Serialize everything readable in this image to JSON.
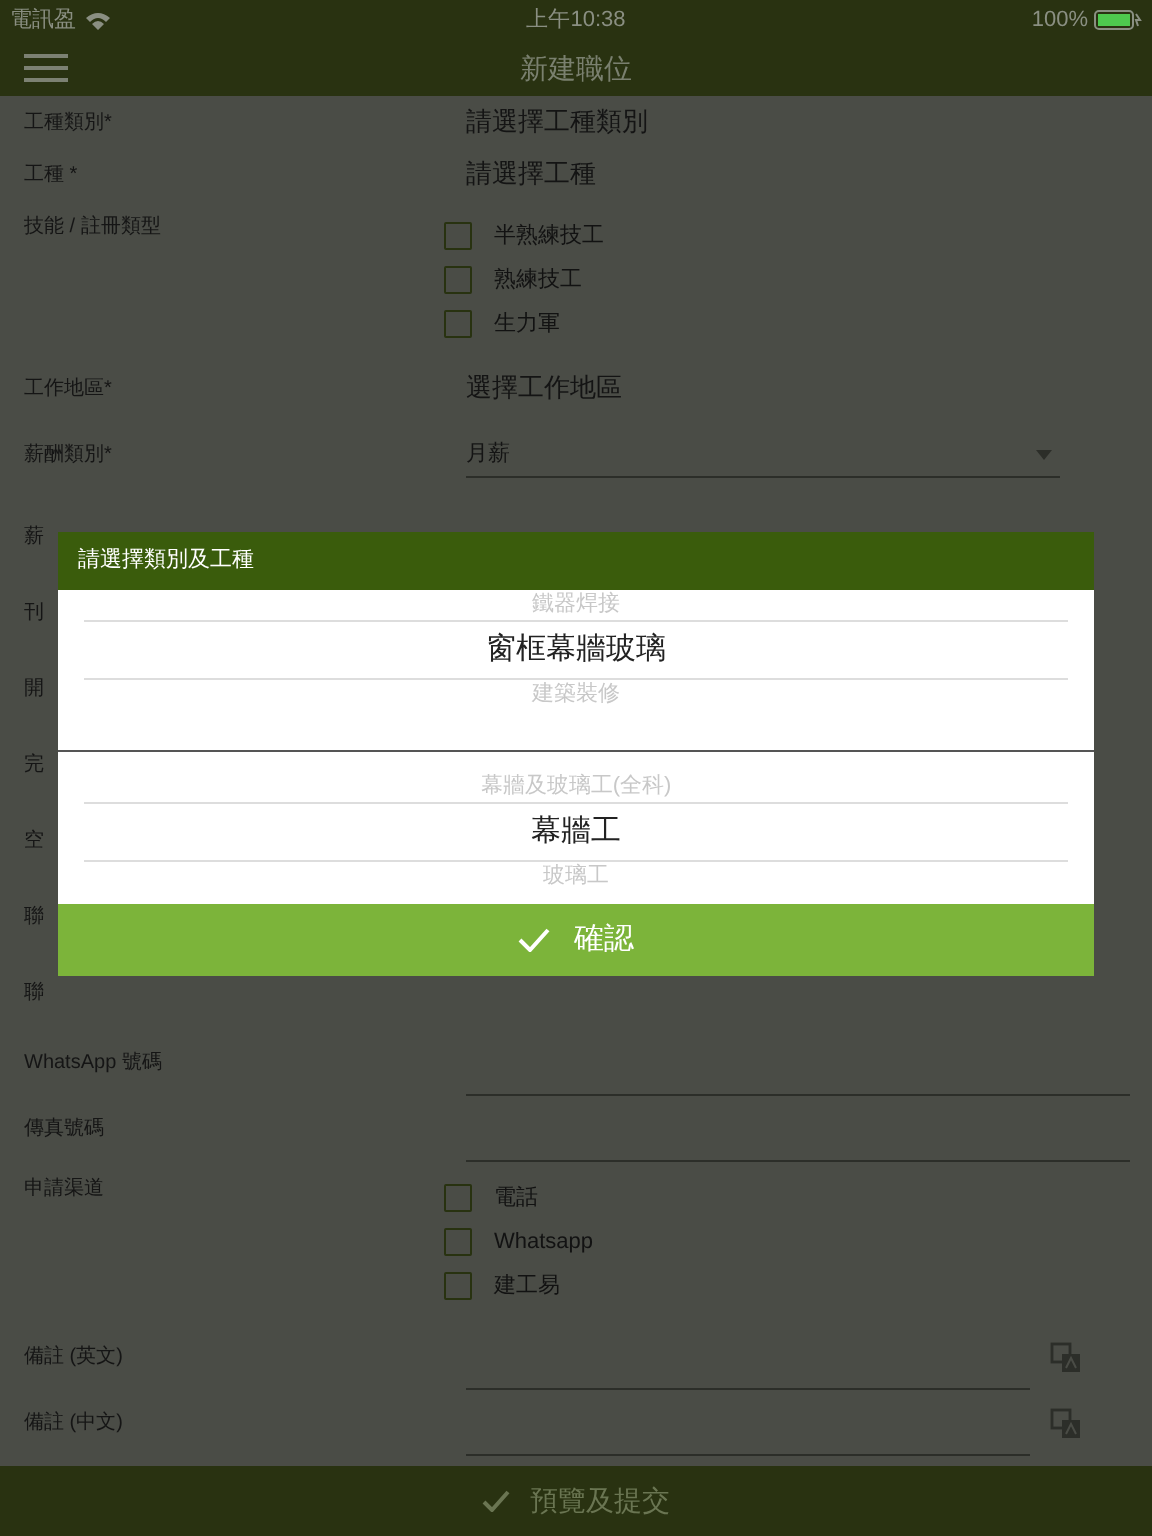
{
  "status_bar": {
    "carrier": "電訊盈",
    "time": "上午10:38",
    "battery": "100%"
  },
  "nav": {
    "title": "新建職位"
  },
  "form": [
    {
      "kind": "select",
      "label": "工種類別*",
      "value": "請選擇工種類別"
    },
    {
      "kind": "select",
      "label": "工種 *",
      "value": "請選擇工種"
    },
    {
      "kind": "checkboxes",
      "label": "技能 / 註冊類型",
      "options": [
        {
          "label": "半熟練技工",
          "checked": false
        },
        {
          "label": "熟練技工",
          "checked": false
        },
        {
          "label": "生力軍",
          "checked": false
        }
      ]
    },
    {
      "kind": "select",
      "label": "工作地區*",
      "value": "選擇工作地區"
    },
    {
      "kind": "dropdown",
      "label": "薪酬類別*",
      "value": "月薪"
    },
    {
      "kind": "covered",
      "label": "薪"
    },
    {
      "kind": "covered",
      "label": "刊"
    },
    {
      "kind": "covered",
      "label": "開"
    },
    {
      "kind": "covered",
      "label": "完"
    },
    {
      "kind": "covered",
      "label": "空"
    },
    {
      "kind": "covered",
      "label": "聯"
    },
    {
      "kind": "covered",
      "label": "聯"
    },
    {
      "kind": "text",
      "label": "WhatsApp 號碼"
    },
    {
      "kind": "text",
      "label": "傳真號碼"
    },
    {
      "kind": "checkboxes",
      "label": "申請渠道",
      "options": [
        {
          "label": "電話",
          "checked": false
        },
        {
          "label": "Whatsapp",
          "checked": false
        },
        {
          "label": "建工易",
          "checked": false
        }
      ]
    },
    {
      "kind": "note",
      "label": "備註 (英文)"
    },
    {
      "kind": "note",
      "label": "備註 (中文)"
    }
  ],
  "dialog": {
    "title": "請選擇類別及工種",
    "pickers": [
      {
        "items": [
          {
            "label": "鐵器焊接",
            "selected": false
          },
          {
            "label": "窗框幕牆玻璃",
            "selected": true
          },
          {
            "label": "建築裝修",
            "selected": false
          }
        ]
      },
      {
        "items": [
          {
            "label": "幕牆及玻璃工(全科)",
            "selected": false
          },
          {
            "label": "幕牆工",
            "selected": true
          },
          {
            "label": "玻璃工",
            "selected": false
          }
        ]
      }
    ],
    "confirm": "確認"
  },
  "submit": "預覽及提交"
}
